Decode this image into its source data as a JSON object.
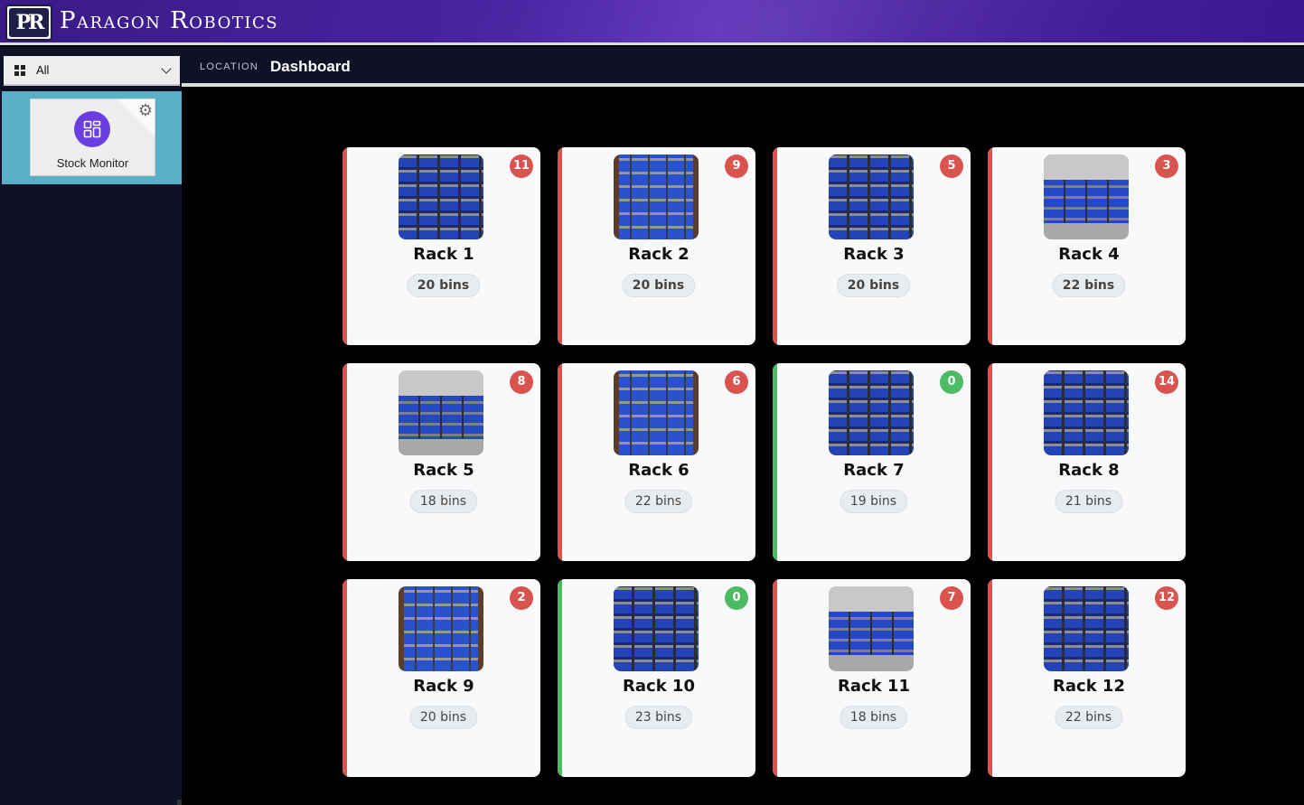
{
  "header": {
    "logo_text": "PR",
    "brand": "Paragon Robotics"
  },
  "sidebar": {
    "filter": {
      "selected": "All",
      "icon": "grid-icon"
    },
    "apps": [
      {
        "label": "Stock Monitor",
        "icon": "dashboard-icon",
        "settings_icon": "gear-icon"
      }
    ]
  },
  "location": {
    "label": "LOCATION",
    "value": "Dashboard"
  },
  "colors": {
    "alert": "#d9534f",
    "ok": "#4cbb64",
    "accent": "#6a3ee0"
  },
  "racks": [
    {
      "name": "Rack 1",
      "bins": "20 bins",
      "alerts": "11",
      "status": "alert"
    },
    {
      "name": "Rack 2",
      "bins": "20 bins",
      "alerts": "9",
      "status": "alert"
    },
    {
      "name": "Rack 3",
      "bins": "20 bins",
      "alerts": "5",
      "status": "alert"
    },
    {
      "name": "Rack 4",
      "bins": "22 bins",
      "alerts": "3",
      "status": "alert"
    },
    {
      "name": "Rack 5",
      "bins": "18 bins",
      "alerts": "8",
      "status": "alert"
    },
    {
      "name": "Rack 6",
      "bins": "22 bins",
      "alerts": "6",
      "status": "alert"
    },
    {
      "name": "Rack 7",
      "bins": "19 bins",
      "alerts": "0",
      "status": "ok"
    },
    {
      "name": "Rack 8",
      "bins": "21 bins",
      "alerts": "14",
      "status": "alert"
    },
    {
      "name": "Rack 9",
      "bins": "20 bins",
      "alerts": "2",
      "status": "alert"
    },
    {
      "name": "Rack 10",
      "bins": "23 bins",
      "alerts": "0",
      "status": "ok"
    },
    {
      "name": "Rack 11",
      "bins": "18 bins",
      "alerts": "7",
      "status": "alert"
    },
    {
      "name": "Rack 12",
      "bins": "22 bins",
      "alerts": "12",
      "status": "alert"
    }
  ]
}
